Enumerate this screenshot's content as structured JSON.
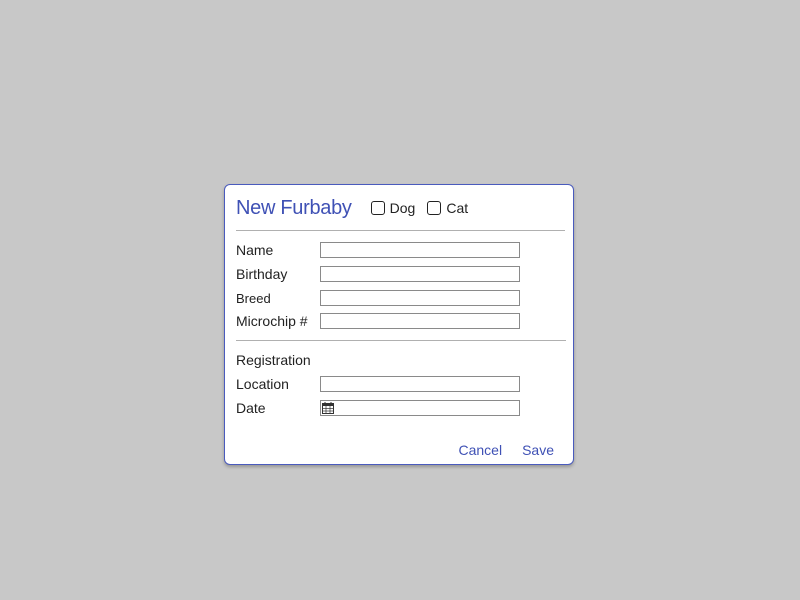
{
  "dialog": {
    "title": "New Furbaby",
    "species_options": [
      {
        "label": "Dog",
        "checked": false
      },
      {
        "label": "Cat",
        "checked": false
      }
    ],
    "fields": [
      {
        "label": "Name",
        "value": ""
      },
      {
        "label": "Birthday",
        "value": ""
      },
      {
        "label": "Breed",
        "value": ""
      },
      {
        "label": "Microchip #",
        "value": ""
      }
    ],
    "registration": {
      "heading": "Registration",
      "fields": [
        {
          "label": "Location",
          "value": ""
        },
        {
          "label": "Date",
          "value": "",
          "icon": "calendar-icon"
        }
      ]
    },
    "actions": {
      "cancel_label": "Cancel",
      "save_label": "Save"
    }
  },
  "colors": {
    "background": "#c8c8c8",
    "dialog_bg": "#ffffff",
    "accent": "#3f51b5",
    "text": "#222222"
  }
}
